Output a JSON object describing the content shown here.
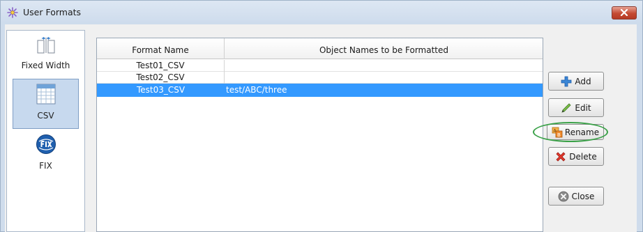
{
  "window": {
    "title": "User Formats",
    "icons": {
      "title": "user-formats-icon",
      "close": "close-x-icon"
    }
  },
  "sidebar": {
    "items": [
      {
        "label": "Fixed Width",
        "icon": "fixed-width-icon",
        "selected": false
      },
      {
        "label": "CSV",
        "icon": "csv-grid-icon",
        "selected": true
      },
      {
        "label": "FIX",
        "icon": "fix-badge-icon",
        "selected": false
      }
    ]
  },
  "table": {
    "columns": [
      "Format Name",
      "Object Names to be Formatted"
    ],
    "rows": [
      {
        "name": "Test01_CSV",
        "objects": ""
      },
      {
        "name": "Test02_CSV",
        "objects": ""
      },
      {
        "name": "Test03_CSV",
        "objects": "test/ABC/three",
        "selected": true
      }
    ]
  },
  "buttons": {
    "add": "Add",
    "edit": "Edit",
    "rename": "Rename",
    "delete": "Delete",
    "close": "Close"
  },
  "colors": {
    "selection": "#3399ff",
    "highlight_ellipse": "#3aa148",
    "titlebar": "#cddbec"
  }
}
